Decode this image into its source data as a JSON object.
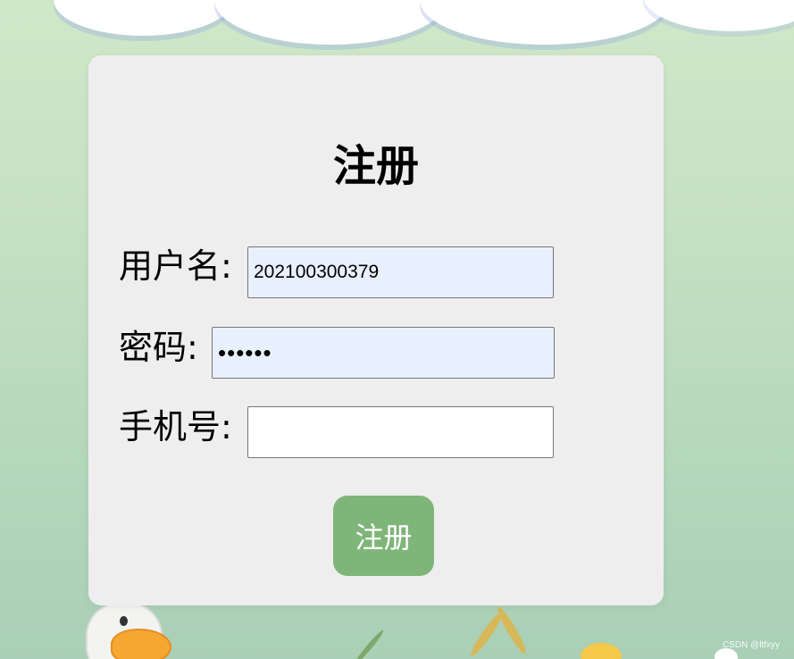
{
  "form": {
    "title": "注册",
    "fields": [
      {
        "label": "用户名:",
        "value": "202100300379",
        "type": "text"
      },
      {
        "label": "密码:",
        "value": "••••••",
        "type": "password"
      },
      {
        "label": "手机号:",
        "value": "",
        "type": "text"
      }
    ],
    "submit_label": "注册"
  },
  "watermark": "CSDN @ltfxyy",
  "colors": {
    "card_bg": "#eeeeee",
    "button_bg": "#80b57a",
    "autofill_bg": "#e8f0fe",
    "page_bg": "#c3dfc2"
  }
}
